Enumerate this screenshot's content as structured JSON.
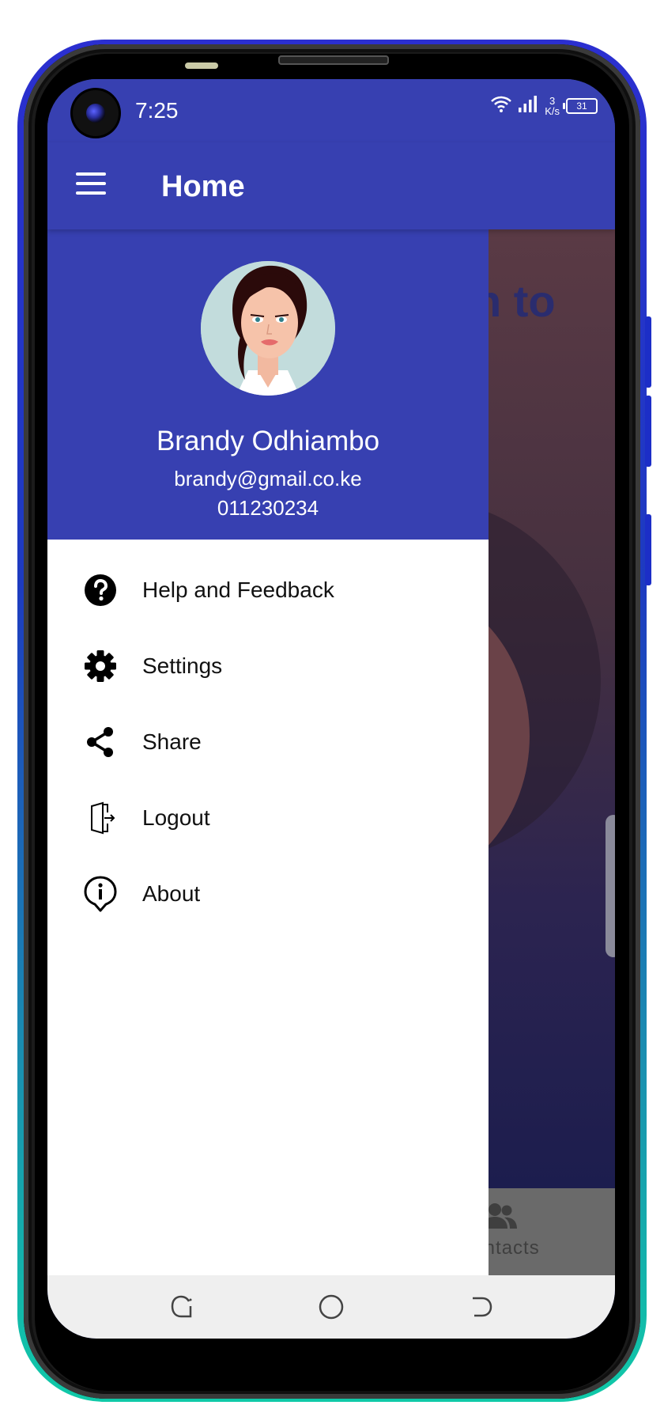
{
  "status_bar": {
    "time": "7:25",
    "net_speed_value": "3",
    "net_speed_unit": "K/s",
    "battery": "31"
  },
  "app_bar": {
    "title": "Home"
  },
  "background": {
    "headline_fragment": "n to",
    "bottom_nav_label": "Contacts"
  },
  "drawer": {
    "user": {
      "name": "Brandy Odhiambo",
      "email": "brandy@gmail.co.ke",
      "phone": "011230234"
    },
    "items": [
      {
        "label": "Help and Feedback",
        "icon": "help-icon"
      },
      {
        "label": "Settings",
        "icon": "gear-icon"
      },
      {
        "label": "Share",
        "icon": "share-icon"
      },
      {
        "label": "Logout",
        "icon": "logout-icon"
      },
      {
        "label": "About",
        "icon": "info-icon"
      }
    ]
  },
  "colors": {
    "primary": "#3740b1",
    "drawer_bg": "#ffffff",
    "scrim": "#1c1d4e",
    "frame_top": "#2b2fd0",
    "frame_bottom": "#10c9a8"
  }
}
